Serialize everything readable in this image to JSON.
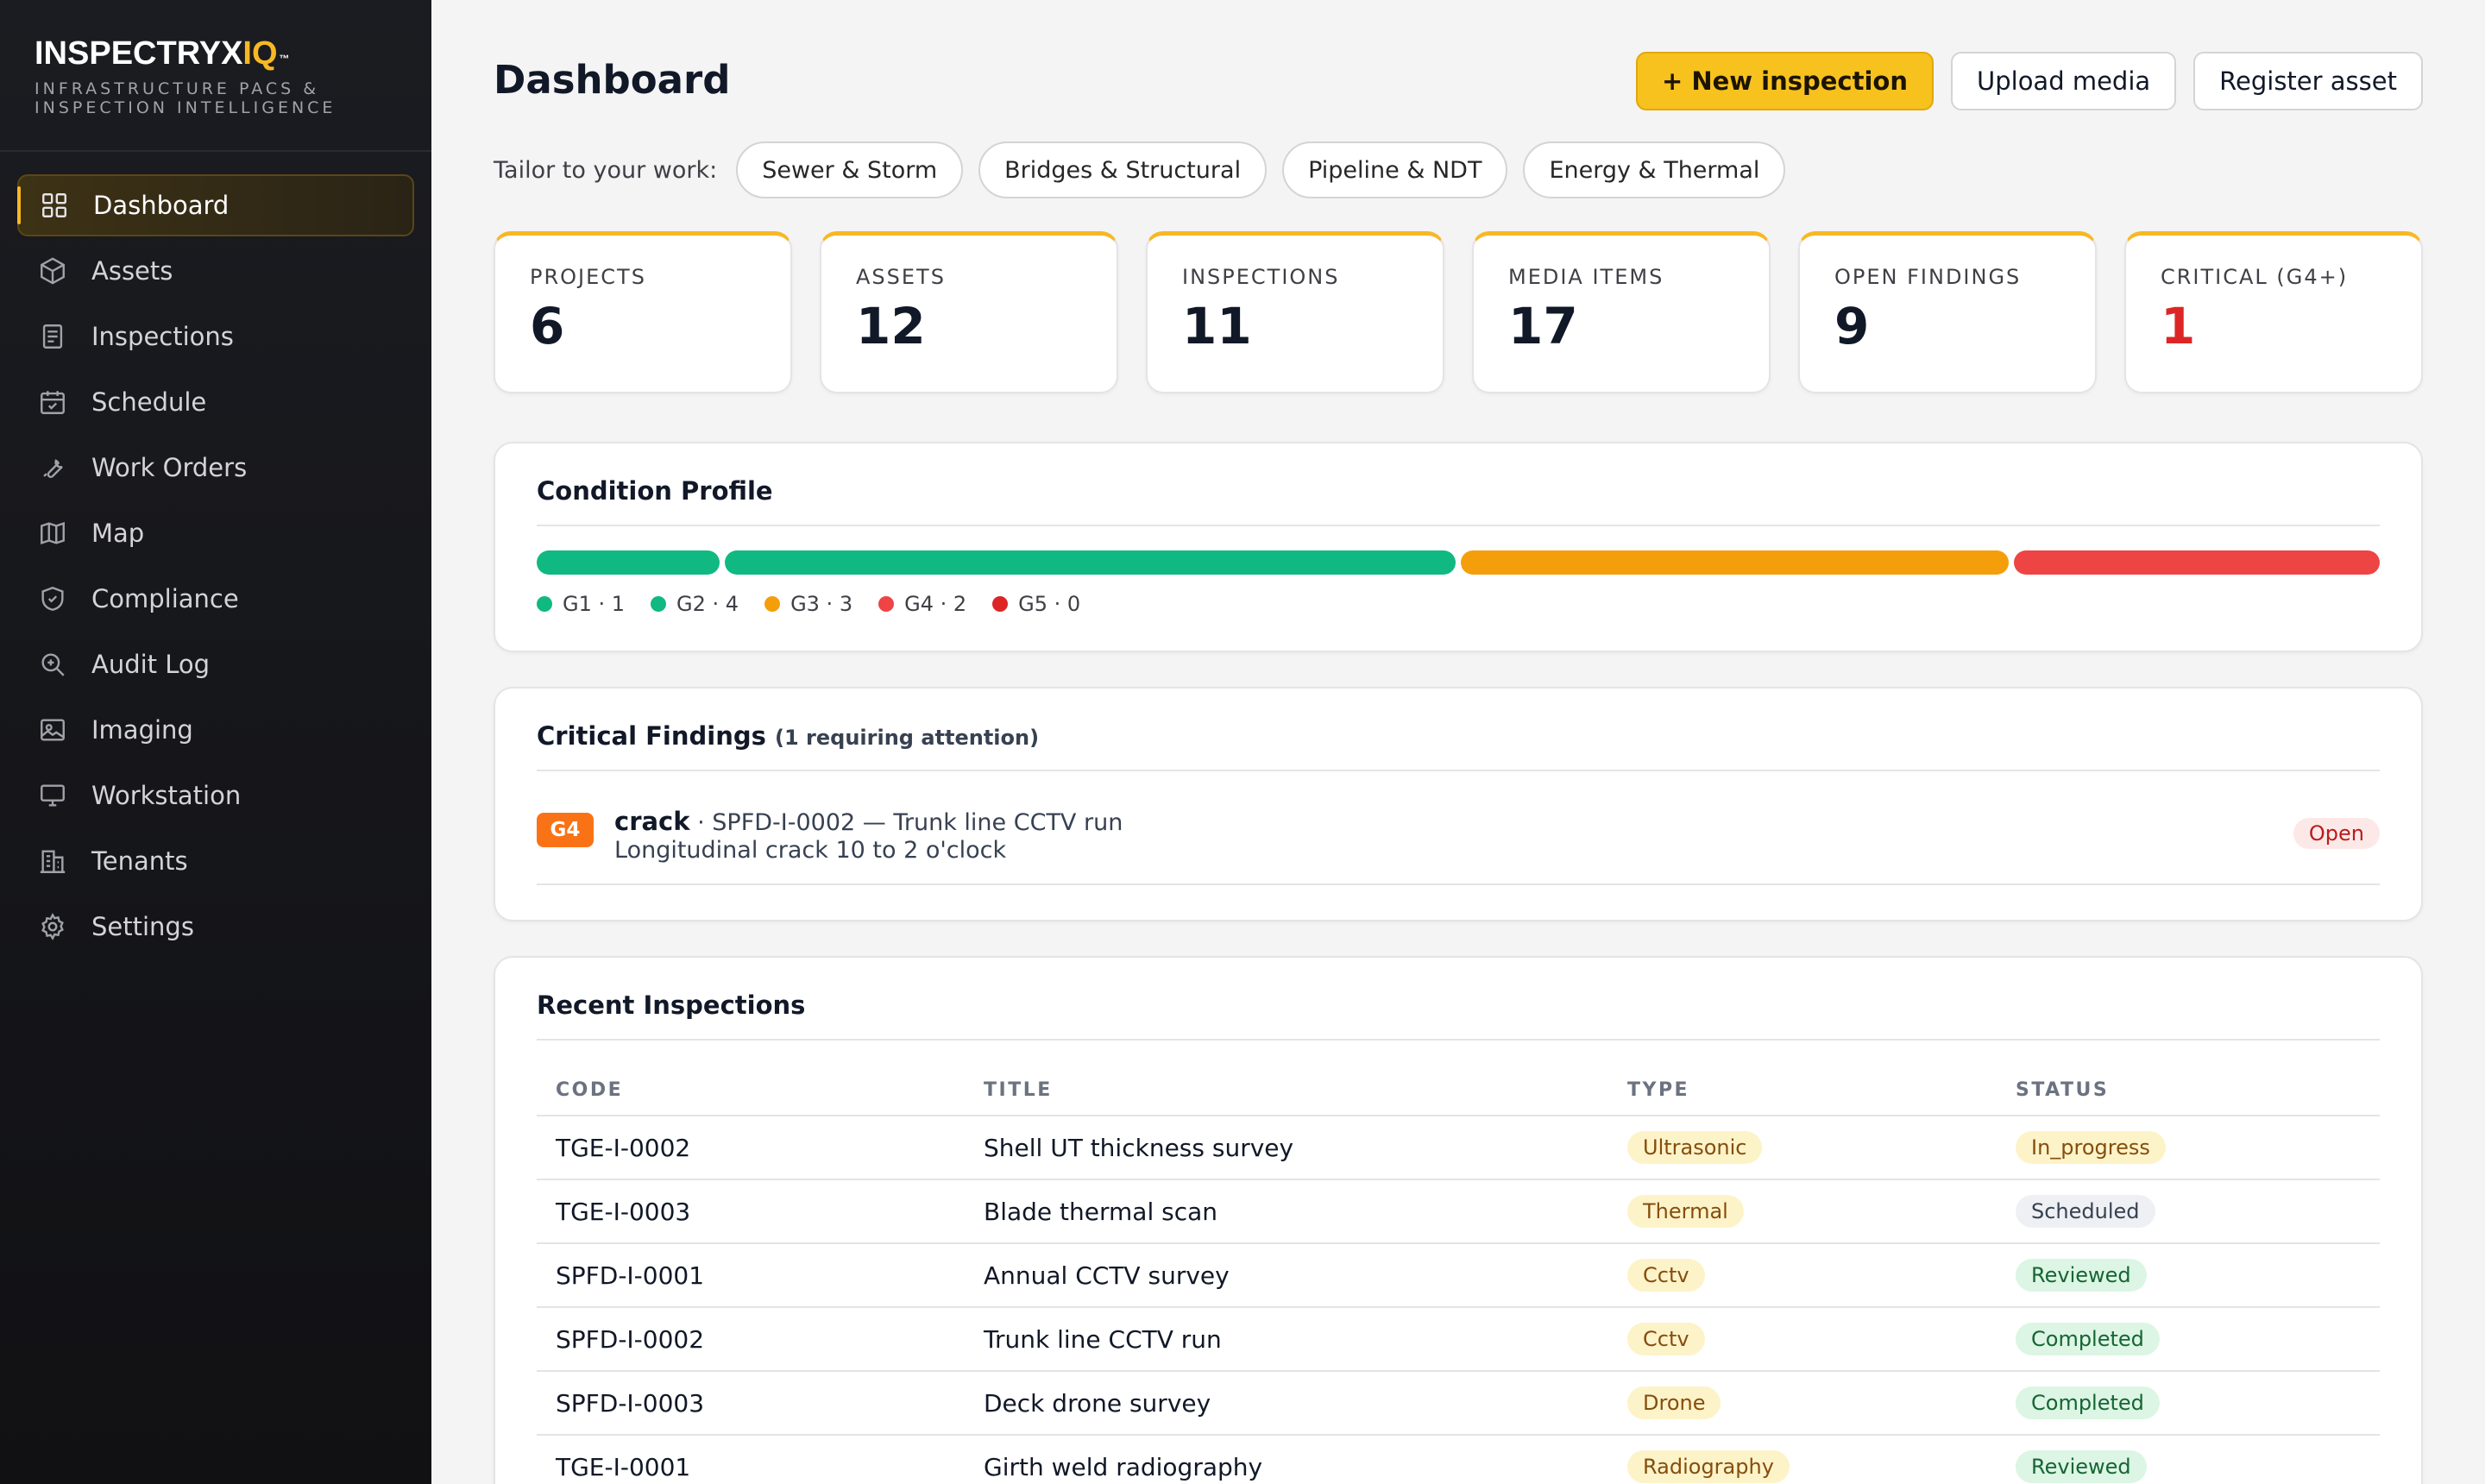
{
  "brand": {
    "name_main": "INSPECTRYX",
    "name_accent": "IQ",
    "tm": "™",
    "tagline": "INFRASTRUCTURE PACS & INSPECTION INTELLIGENCE",
    "accent_color": "#f7b824"
  },
  "sidebar": {
    "items": [
      {
        "label": "Dashboard",
        "icon": "grid-icon",
        "active": true
      },
      {
        "label": "Assets",
        "icon": "cube-icon"
      },
      {
        "label": "Inspections",
        "icon": "document-icon"
      },
      {
        "label": "Schedule",
        "icon": "calendar-icon"
      },
      {
        "label": "Work Orders",
        "icon": "wrench-icon"
      },
      {
        "label": "Map",
        "icon": "map-icon"
      },
      {
        "label": "Compliance",
        "icon": "shield-icon"
      },
      {
        "label": "Audit Log",
        "icon": "magnifier-icon"
      },
      {
        "label": "Imaging",
        "icon": "image-icon"
      },
      {
        "label": "Workstation",
        "icon": "monitor-icon"
      },
      {
        "label": "Tenants",
        "icon": "building-icon"
      },
      {
        "label": "Settings",
        "icon": "gear-icon"
      }
    ]
  },
  "header": {
    "title": "Dashboard",
    "actions": {
      "new_inspection": "+ New inspection",
      "upload_media": "Upload media",
      "register_asset": "Register asset"
    }
  },
  "tailor": {
    "label": "Tailor to your work:",
    "chips": [
      "Sewer & Storm",
      "Bridges & Structural",
      "Pipeline & NDT",
      "Energy & Thermal"
    ]
  },
  "stats": [
    {
      "label": "PROJECTS",
      "value": "6"
    },
    {
      "label": "ASSETS",
      "value": "12"
    },
    {
      "label": "INSPECTIONS",
      "value": "11"
    },
    {
      "label": "MEDIA ITEMS",
      "value": "17"
    },
    {
      "label": "OPEN FINDINGS",
      "value": "9"
    },
    {
      "label": "CRITICAL (G4+)",
      "value": "1"
    }
  ],
  "condition_profile": {
    "title": "Condition Profile",
    "grades": [
      {
        "label": "G1 · 1",
        "count": 1,
        "color": "#10b981"
      },
      {
        "label": "G2 · 4",
        "count": 4,
        "color": "#10b981"
      },
      {
        "label": "G3 · 3",
        "count": 3,
        "color": "#f59e0b"
      },
      {
        "label": "G4 · 2",
        "count": 2,
        "color": "#ef4444"
      },
      {
        "label": "G5 · 0",
        "count": 0,
        "color": "#dc2626"
      }
    ]
  },
  "critical_findings": {
    "title": "Critical Findings",
    "subtitle": "(1 requiring attention)",
    "items": [
      {
        "grade": "G4",
        "kind": "crack",
        "ref": " · SPFD-I-0002 — Trunk line CCTV run",
        "description": "Longitudinal crack 10 to 2 o'clock",
        "status": "Open"
      }
    ]
  },
  "recent_inspections": {
    "title": "Recent Inspections",
    "columns": [
      "CODE",
      "TITLE",
      "TYPE",
      "STATUS"
    ],
    "rows": [
      {
        "code": "TGE-I-0002",
        "title": "Shell UT thickness survey",
        "type": "Ultrasonic",
        "status": "In_progress"
      },
      {
        "code": "TGE-I-0003",
        "title": "Blade thermal scan",
        "type": "Thermal",
        "status": "Scheduled"
      },
      {
        "code": "SPFD-I-0001",
        "title": "Annual CCTV survey",
        "type": "Cctv",
        "status": "Reviewed"
      },
      {
        "code": "SPFD-I-0002",
        "title": "Trunk line CCTV run",
        "type": "Cctv",
        "status": "Completed"
      },
      {
        "code": "SPFD-I-0003",
        "title": "Deck drone survey",
        "type": "Drone",
        "status": "Completed"
      },
      {
        "code": "TGE-I-0001",
        "title": "Girth weld radiography",
        "type": "Radiography",
        "status": "Reviewed"
      }
    ]
  }
}
